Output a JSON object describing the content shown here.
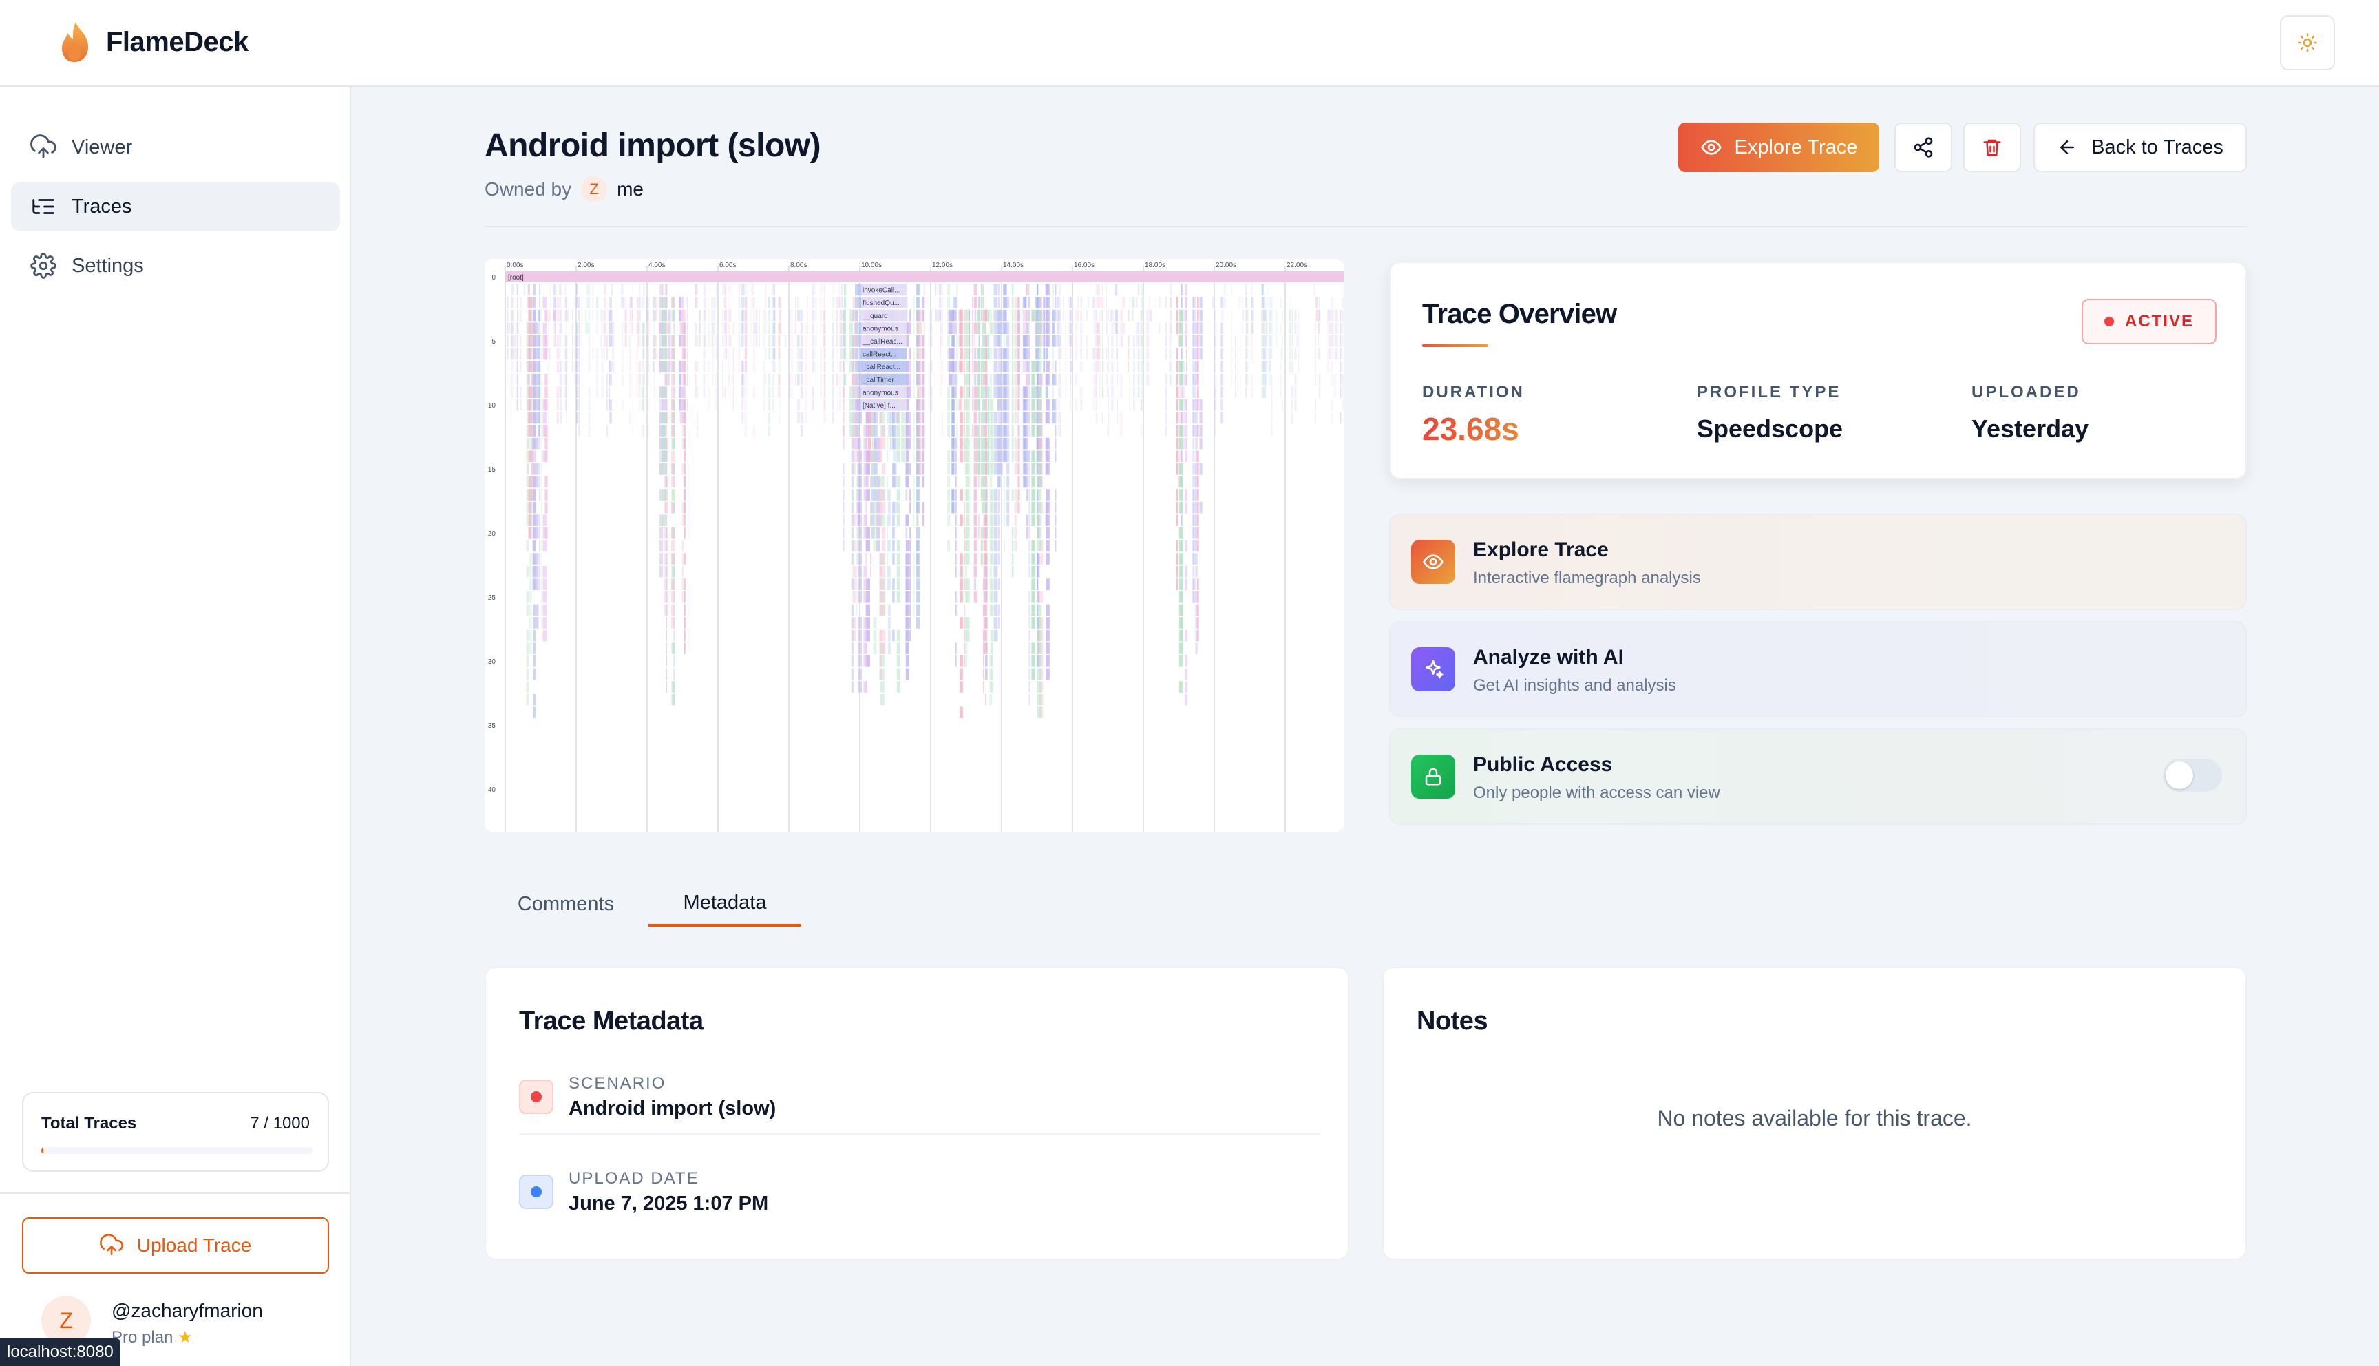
{
  "app": {
    "name": "FlameDeck"
  },
  "sidebar": {
    "items": [
      {
        "label": "Viewer"
      },
      {
        "label": "Traces"
      },
      {
        "label": "Settings"
      }
    ],
    "stats": {
      "label": "Total Traces",
      "value": "7 / 1000",
      "fraction": 0.007
    },
    "upload_label": "Upload Trace",
    "user": {
      "initial": "Z",
      "handle": "@zacharyfmarion",
      "plan": "Pro plan",
      "plan_icon": "star-icon"
    }
  },
  "status_url": "localhost:8080",
  "trace": {
    "title": "Android import (slow)",
    "owned_by_label": "Owned by",
    "owner_initial": "Z",
    "owner_name": "me"
  },
  "toolbar": {
    "explore_label": "Explore Trace",
    "back_label": "Back to Traces"
  },
  "flamegraph": {
    "time_ticks": [
      "0.00s",
      "2.00s",
      "4.00s",
      "6.00s",
      "8.00s",
      "10.00s",
      "12.00s",
      "14.00s",
      "16.00s",
      "18.00s",
      "20.00s",
      "22.00s"
    ],
    "depth_ticks": [
      "0",
      "5",
      "10",
      "15",
      "20",
      "25",
      "30",
      "35",
      "40"
    ],
    "root_label": "[root]",
    "frame_labels": [
      "invokeCall...",
      "flushedQu...",
      "__guard",
      "anonymous",
      "__callReac...",
      "callReact...",
      "_callReact...",
      "_callTimer",
      "anonymous",
      "[Native] f..."
    ]
  },
  "overview": {
    "title": "Trace Overview",
    "badge": "ACTIVE",
    "stats": [
      {
        "label": "DURATION",
        "value": "23.68s"
      },
      {
        "label": "PROFILE TYPE",
        "value": "Speedscope"
      },
      {
        "label": "UPLOADED",
        "value": "Yesterday"
      }
    ]
  },
  "actions": [
    {
      "title": "Explore Trace",
      "subtitle": "Interactive flamegraph analysis",
      "icon": "eye-icon"
    },
    {
      "title": "Analyze with AI",
      "subtitle": "Get AI insights and analysis",
      "icon": "sparkles-icon"
    },
    {
      "title": "Public Access",
      "subtitle": "Only people with access can view",
      "icon": "lock-icon",
      "toggle_on": false
    }
  ],
  "tabs": [
    {
      "label": "Comments"
    },
    {
      "label": "Metadata"
    }
  ],
  "metadata": {
    "title": "Trace Metadata",
    "rows": [
      {
        "label": "SCENARIO",
        "value": "Android import (slow)",
        "color": "#ef4444"
      },
      {
        "label": "UPLOAD DATE",
        "value": "June 7, 2025 1:07 PM",
        "color": "#3b82f6"
      }
    ]
  },
  "notes": {
    "title": "Notes",
    "empty": "No notes available for this trace."
  },
  "colors": {
    "accent": "#ea580c",
    "brand_gradient_start": "#e8563c",
    "brand_gradient_end": "#e9a13a"
  }
}
